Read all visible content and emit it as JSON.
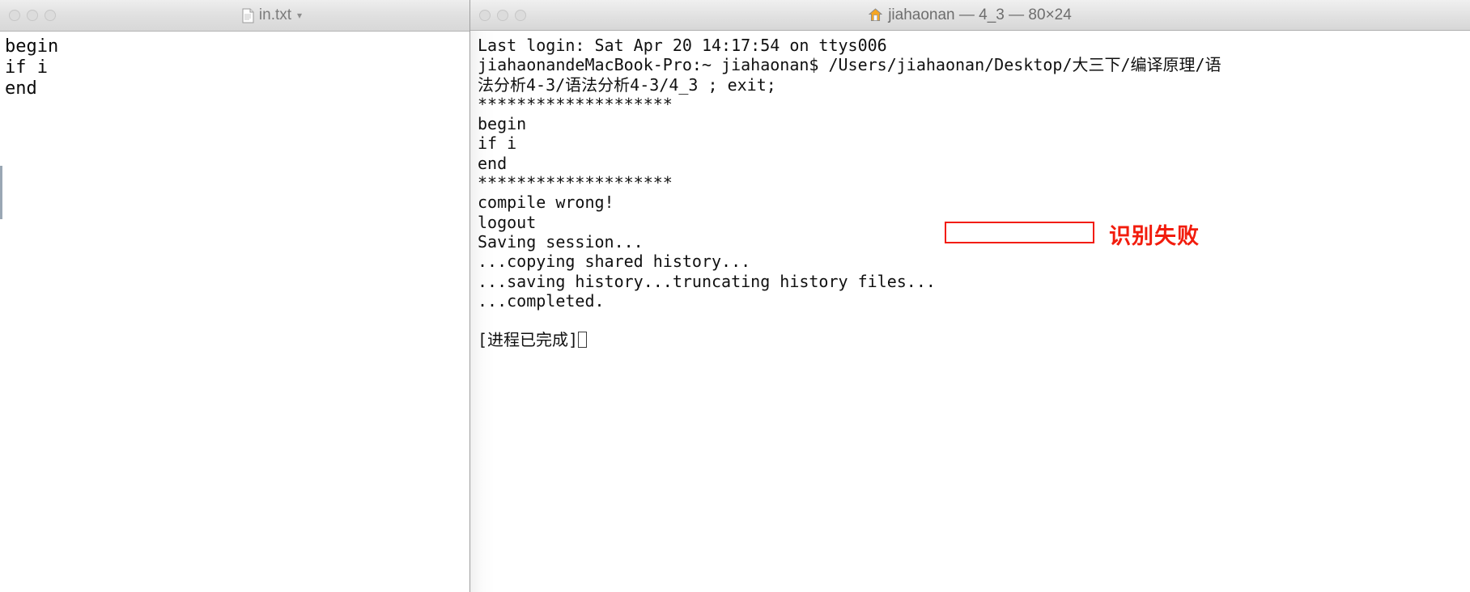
{
  "editor_window": {
    "title": "in.txt",
    "icon": "document-icon",
    "dropdown_icon": "chevron-down-icon",
    "traffic_lights": [
      "close-button",
      "minimize-button",
      "zoom-button"
    ],
    "content_lines": [
      "begin",
      "if i",
      "end"
    ]
  },
  "terminal_window": {
    "title": "jiahaonan — 4_3 — 80×24",
    "icon": "home-icon",
    "traffic_lights": [
      "close-button",
      "minimize-button",
      "zoom-button"
    ],
    "lines": [
      "Last login: Sat Apr 20 14:17:54 on ttys006",
      "jiahaonandeMacBook-Pro:~ jiahaonan$ /Users/jiahaonan/Desktop/大三下/编译原理/语",
      "法分析4-3/语法分析4-3/4_3 ; exit;",
      "********************",
      "begin",
      "if i",
      "end",
      "********************",
      "compile wrong!",
      "logout",
      "Saving session...",
      "...copying shared history...",
      "...saving history...truncating history files...",
      "...completed.",
      "",
      "[进程已完成]"
    ],
    "cursor_after_last_line": true
  },
  "annotation": {
    "highlight_target": "compile wrong!",
    "note_text": "识别失败",
    "color": "#f21c0d"
  }
}
